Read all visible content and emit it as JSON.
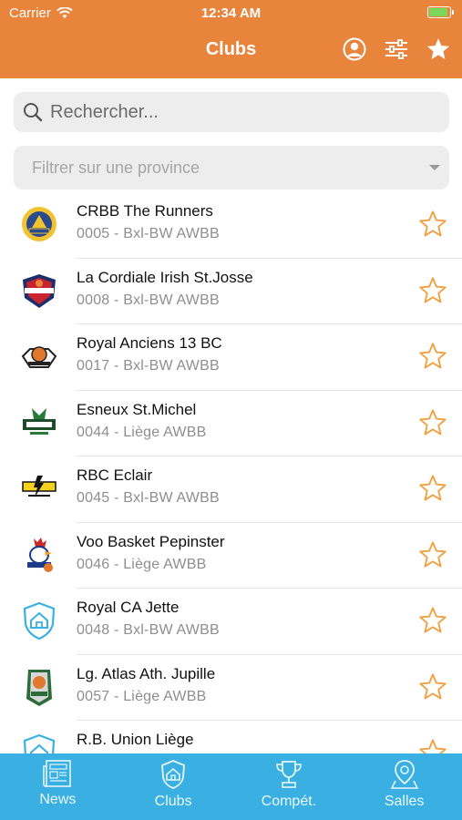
{
  "status_bar": {
    "carrier": "Carrier",
    "time": "12:34 AM"
  },
  "nav": {
    "title": "Clubs",
    "icons": [
      "profile-icon",
      "sliders-icon",
      "star-filled-icon"
    ]
  },
  "search": {
    "placeholder": "Rechercher..."
  },
  "filter": {
    "placeholder": "Filtrer sur une province"
  },
  "colors": {
    "accent": "#e8843c",
    "tabbar": "#3ab0e2",
    "star": "#f0a040"
  },
  "clubs": [
    {
      "name": "CRBB The Runners",
      "sub": "0005 - Bxl-BW AWBB",
      "logo": "crbb-logo"
    },
    {
      "name": "La Cordiale Irish St.Josse",
      "sub": "0008 - Bxl-BW AWBB",
      "logo": "lacordiale-logo"
    },
    {
      "name": "Royal Anciens 13 BC",
      "sub": "0017 - Bxl-BW AWBB",
      "logo": "anciens13-logo"
    },
    {
      "name": "Esneux St.Michel",
      "sub": "0044 - Liège AWBB",
      "logo": "esneux-logo"
    },
    {
      "name": "RBC Eclair",
      "sub": "0045 - Bxl-BW AWBB",
      "logo": "eclair-logo"
    },
    {
      "name": "Voo Basket Pepinster",
      "sub": "0046 - Liège AWBB",
      "logo": "pepinster-logo"
    },
    {
      "name": "Royal CA Jette",
      "sub": "0048 - Bxl-BW AWBB",
      "logo": "default-club-logo"
    },
    {
      "name": "Lg. Atlas Ath. Jupille",
      "sub": "0057 - Liège AWBB",
      "logo": "jupille-logo"
    },
    {
      "name": "R.B. Union Liège",
      "sub": "",
      "logo": "default-club-logo"
    }
  ],
  "tabs": [
    {
      "label": "News",
      "icon": "newspaper-icon"
    },
    {
      "label": "Clubs",
      "icon": "club-shield-icon"
    },
    {
      "label": "Compét.",
      "icon": "trophy-icon"
    },
    {
      "label": "Salles",
      "icon": "map-pin-icon"
    }
  ]
}
